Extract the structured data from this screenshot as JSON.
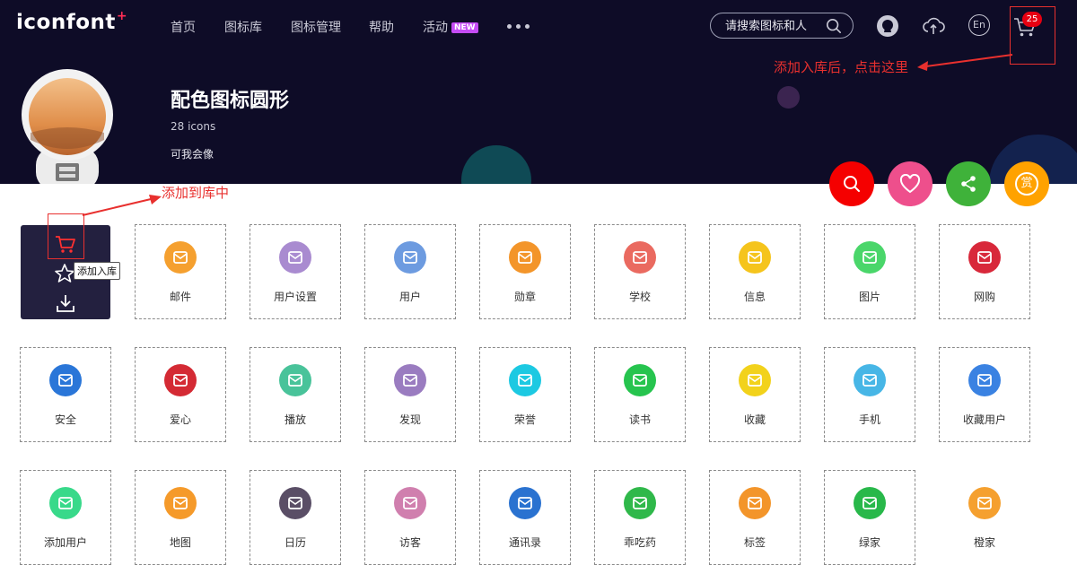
{
  "brand": {
    "logo_text": "iconfont",
    "logo_plus": "+"
  },
  "nav": {
    "items": [
      "首页",
      "图标库",
      "图标管理",
      "帮助",
      "活动"
    ],
    "new_badge": "NEW",
    "more": "more"
  },
  "search": {
    "placeholder": "请搜索图标和人"
  },
  "top_icons": {
    "lang": "En",
    "cart_count": "25"
  },
  "annotations": {
    "cart_hint": "添加入库后，点击这里",
    "add_hint": "添加到库中"
  },
  "collection": {
    "title": "配色图标圆形",
    "count": "28 icons",
    "author": "可我会像"
  },
  "actions": {
    "reward_label": "赏"
  },
  "hover": {
    "tooltip": "添加入库"
  },
  "icons": [
    {
      "label": "邮件",
      "color": "#f5a02f",
      "glyph": "mail-icon"
    },
    {
      "label": "用户设置",
      "color": "#a98bd0",
      "glyph": "user-settings-icon"
    },
    {
      "label": "用户",
      "color": "#6d9be0",
      "glyph": "user-icon"
    },
    {
      "label": "勋章",
      "color": "#f3952a",
      "glyph": "medal-icon"
    },
    {
      "label": "学校",
      "color": "#ea6a60",
      "glyph": "school-icon"
    },
    {
      "label": "信息",
      "color": "#f5c41c",
      "glyph": "message-icon"
    },
    {
      "label": "图片",
      "color": "#4ad66a",
      "glyph": "image-icon"
    },
    {
      "label": "网购",
      "color": "#d8283a",
      "glyph": "shopping-icon"
    },
    {
      "label": "安全",
      "color": "#2a76d8",
      "glyph": "security-icon"
    },
    {
      "label": "爱心",
      "color": "#d42a34",
      "glyph": "love-icon"
    },
    {
      "label": "播放",
      "color": "#49c39a",
      "glyph": "play-icon"
    },
    {
      "label": "发现",
      "color": "#9a7cc0",
      "glyph": "discover-icon"
    },
    {
      "label": "荣誉",
      "color": "#1cc9e2",
      "glyph": "honor-icon"
    },
    {
      "label": "读书",
      "color": "#26c44e",
      "glyph": "book-icon"
    },
    {
      "label": "收藏",
      "color": "#f2d21b",
      "glyph": "favorite-icon"
    },
    {
      "label": "手机",
      "color": "#47b6e6",
      "glyph": "phone-icon"
    },
    {
      "label": "收藏用户",
      "color": "#3a82e2",
      "glyph": "favorite-user-icon"
    },
    {
      "label": "添加用户",
      "color": "#38d98a",
      "glyph": "add-user-icon"
    },
    {
      "label": "地图",
      "color": "#f59a2a",
      "glyph": "map-icon"
    },
    {
      "label": "日历",
      "color": "#5a4e66",
      "glyph": "calendar-icon"
    },
    {
      "label": "访客",
      "color": "#d07fae",
      "glyph": "visitor-icon"
    },
    {
      "label": "通讯录",
      "color": "#2a72d0",
      "glyph": "contacts-icon"
    },
    {
      "label": "乖吃药",
      "color": "#2fb84a",
      "glyph": "medicine-icon"
    },
    {
      "label": "标签",
      "color": "#f3952a",
      "glyph": "tag-icon"
    },
    {
      "label": "绿家",
      "color": "#28b84a",
      "glyph": "green-home-icon"
    },
    {
      "label": "橙家",
      "color": "#f5a02f",
      "glyph": "orange-home-icon"
    }
  ],
  "colors": {
    "banner_bg": "#0e0c27",
    "annotation_red": "#e8302e",
    "search_action": "#f50000",
    "heart_action": "#ee4f8c",
    "share_action": "#3fb23a",
    "reward_action": "#ffa200"
  }
}
